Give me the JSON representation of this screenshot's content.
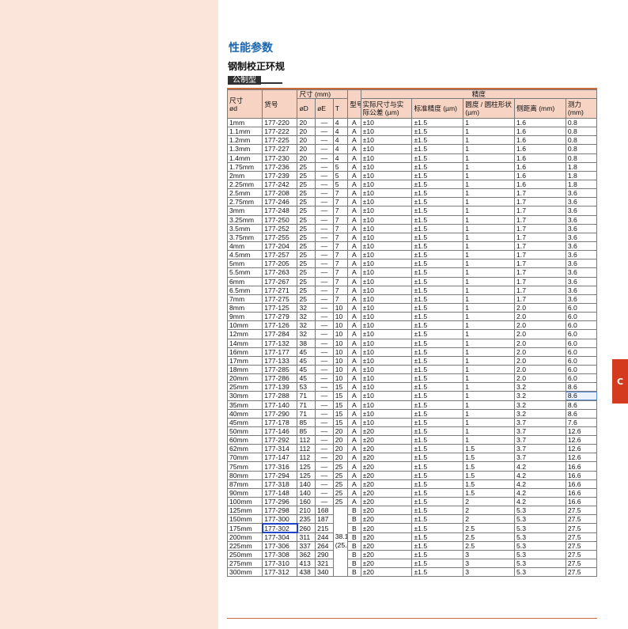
{
  "page": {
    "title": "性能参数",
    "subtitle": "钢制校正环规",
    "chip": "公制型",
    "side_tab": "C"
  },
  "header": {
    "size_top": "尺寸",
    "size_bottom": "ød",
    "code": "货号",
    "dims_group": "尺寸 (mm)",
    "od": "øD",
    "oe": "øE",
    "t": "T",
    "type": "型号",
    "accuracy_group": "精度",
    "deviation": "实际尺寸与实际公差 (µm)",
    "std_accuracy": "标准精度 (µm)",
    "roundness": "圆度 / 圆柱形状 (µm)",
    "gauge_distance": "侧距离 (mm)",
    "measure_force": "测力 (mm)"
  },
  "merged_t_value": "38.1 (25.4)",
  "rows": [
    {
      "size": "1mm",
      "code": "177-220",
      "od": "20",
      "oe": "—",
      "t": "4",
      "type": "A",
      "dev": "±10",
      "std": "±1.5",
      "round": "1",
      "dist": "1.6",
      "force": "0.8"
    },
    {
      "size": "1.1mm",
      "code": "177-222",
      "od": "20",
      "oe": "—",
      "t": "4",
      "type": "A",
      "dev": "±10",
      "std": "±1.5",
      "round": "1",
      "dist": "1.6",
      "force": "0.8"
    },
    {
      "size": "1.2mm",
      "code": "177-225",
      "od": "20",
      "oe": "—",
      "t": "4",
      "type": "A",
      "dev": "±10",
      "std": "±1.5",
      "round": "1",
      "dist": "1.6",
      "force": "0.8"
    },
    {
      "size": "1.3mm",
      "code": "177-227",
      "od": "20",
      "oe": "—",
      "t": "4",
      "type": "A",
      "dev": "±10",
      "std": "±1.5",
      "round": "1",
      "dist": "1.6",
      "force": "0.8"
    },
    {
      "size": "1.4mm",
      "code": "177-230",
      "od": "20",
      "oe": "—",
      "t": "4",
      "type": "A",
      "dev": "±10",
      "std": "±1.5",
      "round": "1",
      "dist": "1.6",
      "force": "0.8"
    },
    {
      "size": "1.75mm",
      "code": "177-236",
      "od": "25",
      "oe": "—",
      "t": "5",
      "type": "A",
      "dev": "±10",
      "std": "±1.5",
      "round": "1",
      "dist": "1.6",
      "force": "1.8"
    },
    {
      "size": "2mm",
      "code": "177-239",
      "od": "25",
      "oe": "—",
      "t": "5",
      "type": "A",
      "dev": "±10",
      "std": "±1.5",
      "round": "1",
      "dist": "1.6",
      "force": "1.8"
    },
    {
      "size": "2.25mm",
      "code": "177-242",
      "od": "25",
      "oe": "—",
      "t": "5",
      "type": "A",
      "dev": "±10",
      "std": "±1.5",
      "round": "1",
      "dist": "1.6",
      "force": "1.8"
    },
    {
      "size": "2.5mm",
      "code": "177-208",
      "od": "25",
      "oe": "—",
      "t": "7",
      "type": "A",
      "dev": "±10",
      "std": "±1.5",
      "round": "1",
      "dist": "1.7",
      "force": "3.6"
    },
    {
      "size": "2.75mm",
      "code": "177-246",
      "od": "25",
      "oe": "—",
      "t": "7",
      "type": "A",
      "dev": "±10",
      "std": "±1.5",
      "round": "1",
      "dist": "1.7",
      "force": "3.6"
    },
    {
      "size": "3mm",
      "code": "177-248",
      "od": "25",
      "oe": "—",
      "t": "7",
      "type": "A",
      "dev": "±10",
      "std": "±1.5",
      "round": "1",
      "dist": "1.7",
      "force": "3.6"
    },
    {
      "size": "3.25mm",
      "code": "177-250",
      "od": "25",
      "oe": "—",
      "t": "7",
      "type": "A",
      "dev": "±10",
      "std": "±1.5",
      "round": "1",
      "dist": "1.7",
      "force": "3.6"
    },
    {
      "size": "3.5mm",
      "code": "177-252",
      "od": "25",
      "oe": "—",
      "t": "7",
      "type": "A",
      "dev": "±10",
      "std": "±1.5",
      "round": "1",
      "dist": "1.7",
      "force": "3.6"
    },
    {
      "size": "3.75mm",
      "code": "177-255",
      "od": "25",
      "oe": "—",
      "t": "7",
      "type": "A",
      "dev": "±10",
      "std": "±1.5",
      "round": "1",
      "dist": "1.7",
      "force": "3.6"
    },
    {
      "size": "4mm",
      "code": "177-204",
      "od": "25",
      "oe": "—",
      "t": "7",
      "type": "A",
      "dev": "±10",
      "std": "±1.5",
      "round": "1",
      "dist": "1.7",
      "force": "3.6"
    },
    {
      "size": "4.5mm",
      "code": "177-257",
      "od": "25",
      "oe": "—",
      "t": "7",
      "type": "A",
      "dev": "±10",
      "std": "±1.5",
      "round": "1",
      "dist": "1.7",
      "force": "3.6"
    },
    {
      "size": "5mm",
      "code": "177-205",
      "od": "25",
      "oe": "—",
      "t": "7",
      "type": "A",
      "dev": "±10",
      "std": "±1.5",
      "round": "1",
      "dist": "1.7",
      "force": "3.6"
    },
    {
      "size": "5.5mm",
      "code": "177-263",
      "od": "25",
      "oe": "—",
      "t": "7",
      "type": "A",
      "dev": "±10",
      "std": "±1.5",
      "round": "1",
      "dist": "1.7",
      "force": "3.6"
    },
    {
      "size": "6mm",
      "code": "177-267",
      "od": "25",
      "oe": "—",
      "t": "7",
      "type": "A",
      "dev": "±10",
      "std": "±1.5",
      "round": "1",
      "dist": "1.7",
      "force": "3.6"
    },
    {
      "size": "6.5mm",
      "code": "177-271",
      "od": "25",
      "oe": "—",
      "t": "7",
      "type": "A",
      "dev": "±10",
      "std": "±1.5",
      "round": "1",
      "dist": "1.7",
      "force": "3.6"
    },
    {
      "size": "7mm",
      "code": "177-275",
      "od": "25",
      "oe": "—",
      "t": "7",
      "type": "A",
      "dev": "±10",
      "std": "±1.5",
      "round": "1",
      "dist": "1.7",
      "force": "3.6"
    },
    {
      "size": "8mm",
      "code": "177-125",
      "od": "32",
      "oe": "—",
      "t": "10",
      "type": "A",
      "dev": "±10",
      "std": "±1.5",
      "round": "1",
      "dist": "2.0",
      "force": "6.0"
    },
    {
      "size": "9mm",
      "code": "177-279",
      "od": "32",
      "oe": "—",
      "t": "10",
      "type": "A",
      "dev": "±10",
      "std": "±1.5",
      "round": "1",
      "dist": "2.0",
      "force": "6.0"
    },
    {
      "size": "10mm",
      "code": "177-126",
      "od": "32",
      "oe": "—",
      "t": "10",
      "type": "A",
      "dev": "±10",
      "std": "±1.5",
      "round": "1",
      "dist": "2.0",
      "force": "6.0"
    },
    {
      "size": "12mm",
      "code": "177-284",
      "od": "32",
      "oe": "—",
      "t": "10",
      "type": "A",
      "dev": "±10",
      "std": "±1.5",
      "round": "1",
      "dist": "2.0",
      "force": "6.0"
    },
    {
      "size": "14mm",
      "code": "177-132",
      "od": "38",
      "oe": "—",
      "t": "10",
      "type": "A",
      "dev": "±10",
      "std": "±1.5",
      "round": "1",
      "dist": "2.0",
      "force": "6.0"
    },
    {
      "size": "16mm",
      "code": "177-177",
      "od": "45",
      "oe": "—",
      "t": "10",
      "type": "A",
      "dev": "±10",
      "std": "±1.5",
      "round": "1",
      "dist": "2.0",
      "force": "6.0"
    },
    {
      "size": "17mm",
      "code": "177-133",
      "od": "45",
      "oe": "—",
      "t": "10",
      "type": "A",
      "dev": "±10",
      "std": "±1.5",
      "round": "1",
      "dist": "2.0",
      "force": "6.0"
    },
    {
      "size": "18mm",
      "code": "177-285",
      "od": "45",
      "oe": "—",
      "t": "10",
      "type": "A",
      "dev": "±10",
      "std": "±1.5",
      "round": "1",
      "dist": "2.0",
      "force": "6.0"
    },
    {
      "size": "20mm",
      "code": "177-286",
      "od": "45",
      "oe": "—",
      "t": "10",
      "type": "A",
      "dev": "±10",
      "std": "±1.5",
      "round": "1",
      "dist": "2.0",
      "force": "6.0"
    },
    {
      "size": "25mm",
      "code": "177-139",
      "od": "53",
      "oe": "—",
      "t": "15",
      "type": "A",
      "dev": "±10",
      "std": "±1.5",
      "round": "1",
      "dist": "3.2",
      "force": "8.6"
    },
    {
      "size": "30mm",
      "code": "177-288",
      "od": "71",
      "oe": "—",
      "t": "15",
      "type": "A",
      "dev": "±10",
      "std": "±1.5",
      "round": "1",
      "dist": "3.2",
      "force": "8.6"
    },
    {
      "size": "35mm",
      "code": "177-140",
      "od": "71",
      "oe": "—",
      "t": "15",
      "type": "A",
      "dev": "±10",
      "std": "±1.5",
      "round": "1",
      "dist": "3.2",
      "force": "8.6"
    },
    {
      "size": "40mm",
      "code": "177-290",
      "od": "71",
      "oe": "—",
      "t": "15",
      "type": "A",
      "dev": "±10",
      "std": "±1.5",
      "round": "1",
      "dist": "3.2",
      "force": "8.6"
    },
    {
      "size": "45mm",
      "code": "177-178",
      "od": "85",
      "oe": "—",
      "t": "15",
      "type": "A",
      "dev": "±10",
      "std": "±1.5",
      "round": "1",
      "dist": "3.7",
      "force": "7.6"
    },
    {
      "size": "50mm",
      "code": "177-146",
      "od": "85",
      "oe": "—",
      "t": "20",
      "type": "A",
      "dev": "±20",
      "std": "±1.5",
      "round": "1",
      "dist": "3.7",
      "force": "12.6"
    },
    {
      "size": "60mm",
      "code": "177-292",
      "od": "112",
      "oe": "—",
      "t": "20",
      "type": "A",
      "dev": "±20",
      "std": "±1.5",
      "round": "1",
      "dist": "3.7",
      "force": "12.6"
    },
    {
      "size": "62mm",
      "code": "177-314",
      "od": "112",
      "oe": "—",
      "t": "20",
      "type": "A",
      "dev": "±20",
      "std": "±1.5",
      "round": "1.5",
      "dist": "3.7",
      "force": "12.6"
    },
    {
      "size": "70mm",
      "code": "177-147",
      "od": "112",
      "oe": "—",
      "t": "20",
      "type": "A",
      "dev": "±20",
      "std": "±1.5",
      "round": "1.5",
      "dist": "3.7",
      "force": "12.6"
    },
    {
      "size": "75mm",
      "code": "177-316",
      "od": "125",
      "oe": "—",
      "t": "25",
      "type": "A",
      "dev": "±20",
      "std": "±1.5",
      "round": "1.5",
      "dist": "4.2",
      "force": "16.6"
    },
    {
      "size": "80mm",
      "code": "177-294",
      "od": "125",
      "oe": "—",
      "t": "25",
      "type": "A",
      "dev": "±20",
      "std": "±1.5",
      "round": "1.5",
      "dist": "4.2",
      "force": "16.6"
    },
    {
      "size": "87mm",
      "code": "177-318",
      "od": "140",
      "oe": "—",
      "t": "25",
      "type": "A",
      "dev": "±20",
      "std": "±1.5",
      "round": "1.5",
      "dist": "4.2",
      "force": "16.6"
    },
    {
      "size": "90mm",
      "code": "177-148",
      "od": "140",
      "oe": "—",
      "t": "25",
      "type": "A",
      "dev": "±20",
      "std": "±1.5",
      "round": "1.5",
      "dist": "4.2",
      "force": "16.6"
    },
    {
      "size": "100mm",
      "code": "177-296",
      "od": "160",
      "oe": "—",
      "t": "25",
      "type": "A",
      "dev": "±20",
      "std": "±1.5",
      "round": "2",
      "dist": "4.2",
      "force": "16.6"
    },
    {
      "size": "125mm",
      "code": "177-298",
      "od": "210",
      "oe": "168",
      "t": "",
      "type": "B",
      "dev": "±20",
      "std": "±1.5",
      "round": "2",
      "dist": "5.3",
      "force": "27.5"
    },
    {
      "size": "150mm",
      "code": "177-300",
      "od": "235",
      "oe": "187",
      "t": "",
      "type": "B",
      "dev": "±20",
      "std": "±1.5",
      "round": "2",
      "dist": "5.3",
      "force": "27.5"
    },
    {
      "size": "175mm",
      "code": "177-302",
      "od": "260",
      "oe": "215",
      "t": "",
      "type": "B",
      "dev": "±20",
      "std": "±1.5",
      "round": "2.5",
      "dist": "5.3",
      "force": "27.5"
    },
    {
      "size": "200mm",
      "code": "177-304",
      "od": "311",
      "oe": "244",
      "t": "",
      "type": "B",
      "dev": "±20",
      "std": "±1.5",
      "round": "2.5",
      "dist": "5.3",
      "force": "27.5"
    },
    {
      "size": "225mm",
      "code": "177-306",
      "od": "337",
      "oe": "264",
      "t": "",
      "type": "B",
      "dev": "±20",
      "std": "±1.5",
      "round": "2.5",
      "dist": "5.3",
      "force": "27.5"
    },
    {
      "size": "250mm",
      "code": "177-308",
      "od": "362",
      "oe": "290",
      "t": "",
      "type": "B",
      "dev": "±20",
      "std": "±1.5",
      "round": "3",
      "dist": "5.3",
      "force": "27.5"
    },
    {
      "size": "275mm",
      "code": "177-310",
      "od": "413",
      "oe": "321",
      "t": "",
      "type": "B",
      "dev": "±20",
      "std": "±1.5",
      "round": "3",
      "dist": "5.3",
      "force": "27.5"
    },
    {
      "size": "300mm",
      "code": "177-312",
      "od": "438",
      "oe": "340",
      "t": "",
      "type": "B",
      "dev": "±20",
      "std": "±1.5",
      "round": "3",
      "dist": "5.3",
      "force": "27.5"
    }
  ]
}
